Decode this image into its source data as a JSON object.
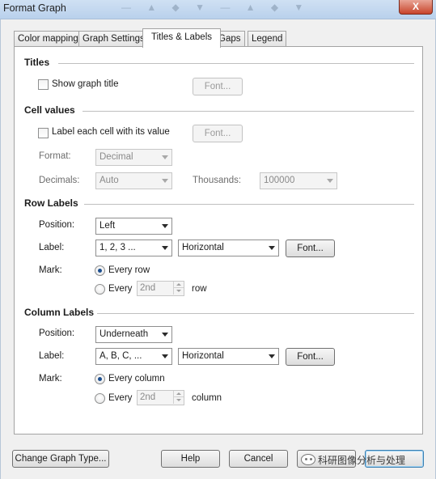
{
  "window": {
    "title": "Format Graph",
    "close_glyph": "X",
    "background_ghost": "— ▲  ◆  ▼   —  ▲  ◆  ▼"
  },
  "tabs": [
    {
      "label": "Color mapping",
      "active": false
    },
    {
      "label": "Graph Settings",
      "active": false
    },
    {
      "label": "Titles & Labels",
      "active": true
    },
    {
      "label": "Gaps",
      "active": false
    },
    {
      "label": "Legend",
      "active": false
    }
  ],
  "titles": {
    "section": "Titles",
    "show_title_label": "Show graph title",
    "show_title_checked": false,
    "font_button": "Font..."
  },
  "cell_values": {
    "section": "Cell values",
    "label_each_label": "Label each cell with its value",
    "label_each_checked": false,
    "font_button": "Font...",
    "format_label": "Format:",
    "format_value": "Decimal",
    "decimals_label": "Decimals:",
    "decimals_value": "Auto",
    "thousands_label": "Thousands:",
    "thousands_value": "100000"
  },
  "row_labels": {
    "section": "Row Labels",
    "position_label": "Position:",
    "position_value": "Left",
    "label_label": "Label:",
    "label_value": "1, 2, 3 ...",
    "orientation_value": "Horizontal",
    "font_button": "Font...",
    "mark_label": "Mark:",
    "every_row_label": "Every row",
    "every_label": "Every",
    "every_value": "2nd",
    "unit_label": "row",
    "selected": "every_row"
  },
  "column_labels": {
    "section": "Column Labels",
    "position_label": "Position:",
    "position_value": "Underneath",
    "label_label": "Label:",
    "label_value": "A, B, C, ...",
    "orientation_value": "Horizontal",
    "font_button": "Font...",
    "mark_label": "Mark:",
    "every_column_label": "Every column",
    "every_label": "Every",
    "every_value": "2nd",
    "unit_label": "column",
    "selected": "every_column"
  },
  "footer": {
    "change_type": "Change Graph Type...",
    "help": "Help",
    "cancel": "Cancel",
    "watermark": "科研图像分析与处理"
  }
}
